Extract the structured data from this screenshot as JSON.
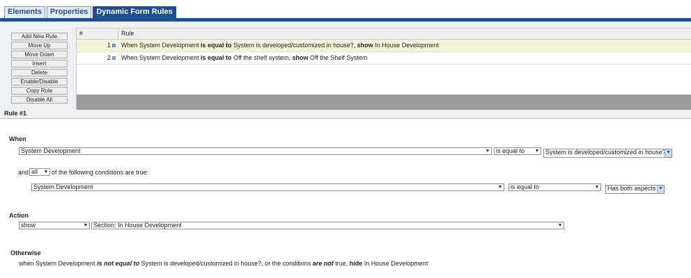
{
  "tabs": [
    {
      "label": "Elements"
    },
    {
      "label": "Properties"
    },
    {
      "label": "Dynamic Form Rules"
    }
  ],
  "buttons": {
    "add_new_rule": "Add New Rule",
    "move_up": "Move Up",
    "move_down": "Move Down",
    "insert": "Insert",
    "delete": "Delete",
    "enable_disable": "Enable/Disable",
    "copy_rule": "Copy Rule",
    "disable_all": "Disable All"
  },
  "grid": {
    "headers": {
      "num": "#",
      "rule": "Rule"
    },
    "rows": [
      {
        "num": "1",
        "w1": "When System Development ",
        "op": "is equal to",
        "w2": " System is developed/customized in house?, ",
        "act": "show",
        "w3": " In House Development"
      },
      {
        "num": "2",
        "w1": "When System Development ",
        "op": "is equal to",
        "w2": " Off the shelf system, ",
        "act": "show",
        "w3": " Off the Shelf System"
      }
    ]
  },
  "rule_label": "Rule #1",
  "when": {
    "heading": "When",
    "field": "System Development",
    "operator": "is equal to",
    "value": "System is developed/customized in house?"
  },
  "conditions": {
    "prefix": "and",
    "quantifier": "all",
    "suffix": "of the following conditions are true:",
    "field": "System Development",
    "operator": "is equal to",
    "value": "Has both aspects"
  },
  "action": {
    "heading": "Action",
    "verb": "show",
    "target": "Section: In House Development"
  },
  "otherwise": {
    "heading": "Otherwise",
    "t1": "when System Development ",
    "op": "is not equal to",
    "t2": " System is developed/customized in house?, or the conditions ",
    "neg": "are not",
    "t3": " true, ",
    "act": "hide",
    "t4": " In House Development"
  }
}
